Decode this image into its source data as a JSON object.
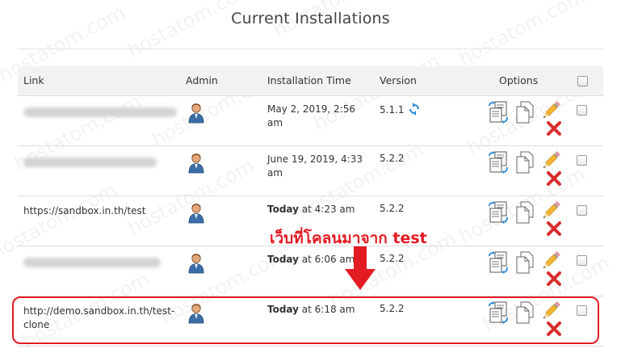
{
  "page": {
    "title": "Current Installations"
  },
  "table": {
    "headers": {
      "link": "Link",
      "admin": "Admin",
      "installation_time": "Installation Time",
      "version": "Version",
      "options": "Options"
    },
    "rows": [
      {
        "link": "",
        "link_blurred": true,
        "time_prefix": "",
        "time": "May 2, 2019, 2:56 am",
        "version": "5.1.1",
        "has_update_icon": true,
        "selected": false
      },
      {
        "link": "",
        "link_blurred": true,
        "time_prefix": "",
        "time": "June 19, 2019, 4:33 am",
        "version": "5.2.2",
        "has_update_icon": false,
        "selected": false
      },
      {
        "link": "https://sandbox.in.th/test",
        "link_blurred": false,
        "time_prefix": "Today",
        "time": " at 4:23 am",
        "version": "5.2.2",
        "has_update_icon": false,
        "selected": false
      },
      {
        "link": "",
        "link_blurred": true,
        "time_prefix": "Today",
        "time": " at 6:06 am",
        "version": "5.2.2",
        "has_update_icon": false,
        "selected": false
      },
      {
        "link": "http://demo.sandbox.in.th/test-clone",
        "link_blurred": false,
        "time_prefix": "Today",
        "time": " at 6:18 am",
        "version": "5.2.2",
        "has_update_icon": false,
        "selected": false
      }
    ]
  },
  "annotation": {
    "callout": "เว็บที่โคลนมาจาก test",
    "color": "#e31b23"
  },
  "watermark": "hostatom.com",
  "icons": {
    "admin": "admin-user-icon",
    "update": "update-refresh-icon",
    "clone": "clone-icon",
    "copy": "copy-icon",
    "edit": "edit-pencil-icon",
    "remove": "remove-x-icon"
  }
}
